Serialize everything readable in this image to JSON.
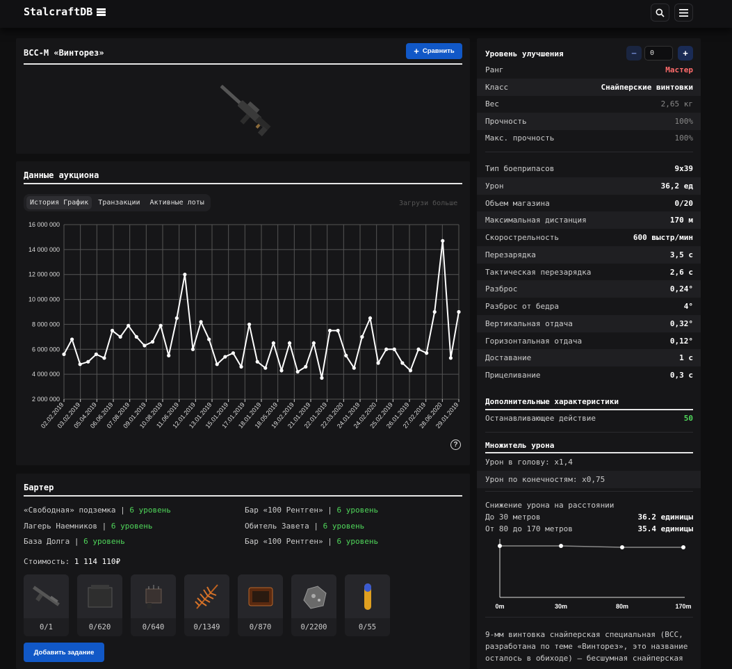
{
  "header": {
    "logo": "StalcraftDB"
  },
  "item": {
    "name": "ВСС-М «Винторез»",
    "compare_label": "Сравнить"
  },
  "auction": {
    "title": "Данные аукциона",
    "tabs": [
      {
        "label": "История График",
        "active": true
      },
      {
        "label": "Транзакции"
      },
      {
        "label": "Активные лоты"
      }
    ],
    "load_more": "Загрузи больше"
  },
  "chart_data": {
    "type": "line",
    "ylim": [
      2000000,
      16000000
    ],
    "yticks": [
      "2 000 000",
      "4 000 000",
      "6 000 000",
      "8 000 000",
      "10 000 000",
      "12 000 000",
      "14 000 000",
      "16 000 000"
    ],
    "xticks": [
      "02.02.2019",
      "03.02.2019",
      "05.04.2019",
      "06.06.2019",
      "07.08.2019",
      "09.01.2019",
      "10.08.2019",
      "11.06.2019",
      "12.01.2019",
      "13.01.2019",
      "15.01.2019",
      "17.01.2019",
      "18.01.2019",
      "18.05.2019",
      "19.02.2019",
      "21.01.2019",
      "22.01.2019",
      "22.03.2020",
      "24.01.2019",
      "24.02.2020",
      "25.02.2019",
      "26.01.2019",
      "27.02.2019",
      "28.06.2020",
      "29.01.2019"
    ],
    "values": [
      5600000,
      6800000,
      4800000,
      5000000,
      5600000,
      5300000,
      7500000,
      7000000,
      7900000,
      7000000,
      6300000,
      6600000,
      7900000,
      5500000,
      8500000,
      12000000,
      6000000,
      8200000,
      6800000,
      4800000,
      5400000,
      5700000,
      4600000,
      8000000,
      5000000,
      4500000,
      6500000,
      4300000,
      6500000,
      4200000,
      4600000,
      6500000,
      3700000,
      7500000,
      7500000,
      5500000,
      4500000,
      7000000,
      8500000,
      4900000,
      6000000,
      6000000,
      4900000,
      4300000,
      6000000,
      5700000,
      9000000,
      14700000,
      5300000,
      9000000
    ],
    "grid": true
  },
  "barter": {
    "title": "Бартер",
    "rows": [
      {
        "place": "«Свободная» подземка",
        "level": "6 уровень"
      },
      {
        "place": "Бар «100 Рентген»",
        "level": "6 уровень"
      },
      {
        "place": "Лагерь Наемников",
        "level": "6 уровень"
      },
      {
        "place": "Обитель Завета",
        "level": "6 уровень"
      },
      {
        "place": "База Долга",
        "level": "6 уровень"
      },
      {
        "place": "Бар «100 Рентген»",
        "level": "6 уровень"
      }
    ],
    "cost_label": "Стоимость:",
    "cost_value": "1 114 110₽",
    "items": [
      {
        "count": "0/1",
        "icon": "rifle-icon"
      },
      {
        "count": "0/620",
        "icon": "ammo-box-icon"
      },
      {
        "count": "0/640",
        "icon": "device-icon"
      },
      {
        "count": "0/1349",
        "icon": "fern-icon"
      },
      {
        "count": "0/870",
        "icon": "tablet-icon"
      },
      {
        "count": "0/2200",
        "icon": "ore-icon"
      },
      {
        "count": "0/55",
        "icon": "vial-icon"
      }
    ],
    "add_task_label": "Добавить задание"
  },
  "upgrade": {
    "label": "Уровень улучшения",
    "value": "0",
    "minus": "−",
    "plus": "+"
  },
  "stats_basic": [
    {
      "k": "Ранг",
      "v": "Мастер",
      "style": "red"
    },
    {
      "k": "Класс",
      "v": "Снайперские винтовки",
      "style": ""
    },
    {
      "k": "Вес",
      "v": "2,65 кг",
      "style": "dim"
    },
    {
      "k": "Прочность",
      "v": "100%",
      "style": "dim"
    },
    {
      "k": "Макс. прочность",
      "v": "100%",
      "style": "dim"
    }
  ],
  "stats_combat": [
    {
      "k": "Тип боеприпасов",
      "v": "9x39"
    },
    {
      "k": "Урон",
      "v": "36,2 ед"
    },
    {
      "k": "Объем магазина",
      "v": "0/20"
    },
    {
      "k": "Максимальная дистанция",
      "v": "170 м"
    },
    {
      "k": "Скорострельность",
      "v": "600 выстр/мин"
    },
    {
      "k": "Перезарядка",
      "v": "3,5 с"
    },
    {
      "k": "Тактическая перезарядка",
      "v": "2,6 с"
    },
    {
      "k": "Разброс",
      "v": "0,24°"
    },
    {
      "k": "Разброс от бедра",
      "v": "4°"
    },
    {
      "k": "Вертикальная отдача",
      "v": "0,32°"
    },
    {
      "k": "Горизонтальная отдача",
      "v": "0,12°"
    },
    {
      "k": "Доставание",
      "v": "1 с"
    },
    {
      "k": "Прицеливание",
      "v": "0,3 с"
    }
  ],
  "extra": {
    "title": "Дополнительные характеристики",
    "k": "Останавливающее действие",
    "v": "50"
  },
  "multiplier": {
    "title": "Множитель урона",
    "head": "Урон в голову: x1,4",
    "limbs": "Урон по конечностям: x0,75"
  },
  "falloff": {
    "title": "Снижение урона на расстоянии",
    "rows": [
      {
        "k": "До 30 метров",
        "v": "36.2 единицы"
      },
      {
        "k": "От 80 до 170 метров",
        "v": "35.4 единицы"
      }
    ],
    "labels": [
      "0m",
      "30m",
      "80m",
      "170m"
    ]
  },
  "description": "9-мм винтовка снайперская специальная (ВСС, разработана по теме «Винторез», это название осталось в обиходе) – бесшумная снайперская"
}
